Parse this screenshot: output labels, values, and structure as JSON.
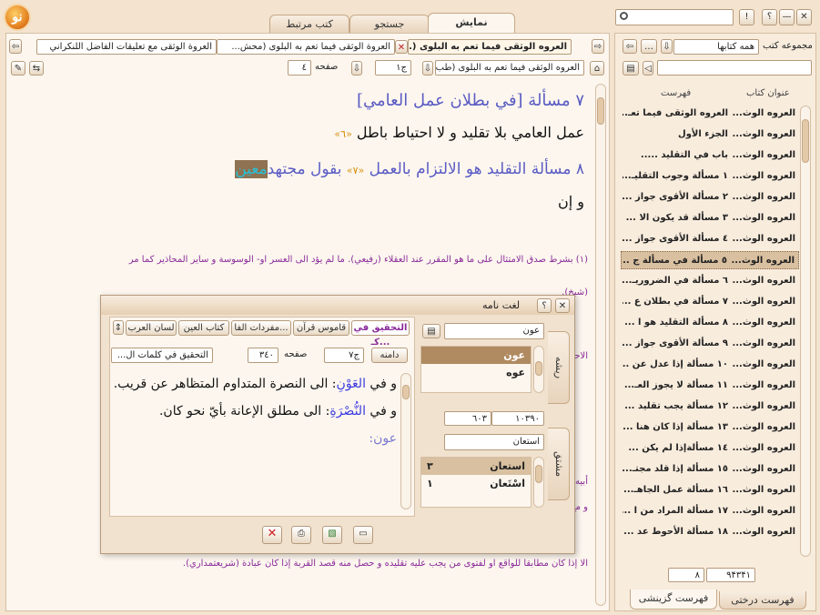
{
  "window": {
    "close": "✕",
    "minimize": "—",
    "help": "؟",
    "info": "!"
  },
  "search": {
    "placeholder": ""
  },
  "main_tabs": [
    "نمایش",
    "جستجو",
    "کتب مرتبط"
  ],
  "doc_tabs": [
    "العروه الوثقى فيما تعم به البلوى (...",
    "العروة الوثقى فيما تعم به البلوى (محش...",
    "العروة الوثقى مع تعليقات الفاضل اللنكراني"
  ],
  "book_select": "العروه الوثقى فيما تعم به البلوى (طب...",
  "volume": "ج١",
  "page_label": "صفحه",
  "page_value": "٤",
  "content": {
    "heading1": "٧ مسألة [في بطلان عمل العامي]",
    "line1": "عمل العامي بلا تقليد و لا احتياط باطل",
    "note1": "«٦»",
    "heading2": "٨ مسألة التقليد هو الالتزام بالعمل",
    "note2": "«٧»",
    "heading2_end": "بقول مجتهد",
    "heading2_hl": "معين",
    "line2": "و إن",
    "footnote1": "(١) بشرط صدق الامتثال على ما هو المقرر عند العقلاء (رفيعي). ما لم يؤد الى العسر او- الوسوسة و ساير المحاذير كما مر",
    "footnote1b": "(شيخ).",
    "side1": "الاحتياط في هذه",
    "side2": "أبيه (ح). إذا خالف",
    "side3": "و مع عدم الاعتماد",
    "footnote_last": "الا إذا كان مطابقا للواقع او لفتوى من يجب عليه تقليده و حصل منه قصد القربة إذا كان عبادة (شريعتمداري)."
  },
  "right_panel": {
    "group_label": "مجموعه کتب",
    "group_value": "همه کتابها",
    "col_index": "فهرست",
    "col_title": "عنوان كتاب",
    "rows": [
      {
        "title": "العروه الوث...",
        "index": "العروه الوثقى فيما تعـ..."
      },
      {
        "title": "العروه الوث...",
        "index": "الجزء الأول"
      },
      {
        "title": "العروه الوث...",
        "index": "باب في التقليد ....."
      },
      {
        "title": "العروه الوث...",
        "index": "١ مسألة وجوب التقليـ..."
      },
      {
        "title": "العروه الوث...",
        "index": "٢ مسألة الأقوى جواز ..."
      },
      {
        "title": "العروه الوث...",
        "index": "٣ مسألة قد يكون الا ..."
      },
      {
        "title": "العروه الوث...",
        "index": "٤ مسألة الأقوى جواز ..."
      },
      {
        "title": "العروه الوث...",
        "index": "٥ مسألة في مسألة ج ..."
      },
      {
        "title": "العروه الوث...",
        "index": "٦ مسألة في الضروريـ..."
      },
      {
        "title": "العروه الوث...",
        "index": "٧ مسألة في بطلان ع ..."
      },
      {
        "title": "العروه الوث...",
        "index": "٨ مسألة التقليد هو ا ..."
      },
      {
        "title": "العروه الوث...",
        "index": "٩ مسألة الأقوى جواز ..."
      },
      {
        "title": "العروه الوث...",
        "index": "١٠ مسألة إذا عدل عن ..."
      },
      {
        "title": "العروه الوث...",
        "index": "١١ مسألة لا يجوز العـ..."
      },
      {
        "title": "العروه الوث...",
        "index": "١٢ مسألة يجب تقليد ..."
      },
      {
        "title": "العروه الوث...",
        "index": "١٣ مسألة إذا كان هنا ..."
      },
      {
        "title": "العروه الوث...",
        "index": "١٤ مسألةإذا لم يكن ..."
      },
      {
        "title": "العروه الوث...",
        "index": "١٥ مسألة إذا قلد مجتـ..."
      },
      {
        "title": "العروه الوث...",
        "index": "١٦ مسألة عمل الجاهـ..."
      },
      {
        "title": "العروه الوث...",
        "index": "١٧ مسألة المراد من ا ..."
      },
      {
        "title": "العروه الوث...",
        "index": "١٨ مسألة الأحوط عد ..."
      }
    ],
    "selected_index": 7,
    "count1": "٩۴٣۴١",
    "count2": "٨",
    "bottom_tabs": [
      "فهرست درختی",
      "فهرست گزینشی"
    ]
  },
  "dialog": {
    "title": "لغت نامه",
    "dict_tabs": [
      "التحقيق في كـ...",
      "قاموس قرآن",
      "مفردات الفا...",
      "كتاب العين",
      "لسان العرب"
    ],
    "source_select": "التحقيق في كلمات ال...",
    "domain_btn": "دامنه",
    "volume": "ج٧",
    "page_label": "صفحه",
    "page_value": "٣٤٠",
    "text_line1_pre": "و في",
    "text_line1_word": "العَوْنِ",
    "text_line1_rest": ": الى النصرة المتداوم المتظاهر عن قريب.",
    "text_line2_pre": "و في",
    "text_line2_word": "النُّصْرَةِ",
    "text_line2_rest": ": الى مطلق الإعانة بأيّ نحو كان.",
    "text_line3": "عون:",
    "root_search": "عون",
    "root_list": [
      "عون",
      "عوه"
    ],
    "root_selected": 0,
    "range_from": "٦٠٣",
    "range_to": "١٠٣٩٠",
    "derived_search": "استعان",
    "derived_list": [
      {
        "word": "استعان",
        "count": "٣"
      },
      {
        "word": "اسْتَعان",
        "count": "١"
      }
    ],
    "derived_selected": 0,
    "side_label1": "ریشه",
    "side_label2": "مشتق"
  },
  "colors": {
    "accent": "#8a2a9a",
    "heading": "#5a5bc4",
    "highlight_bg": "#8e7252",
    "highlight_fg": "#28c0d6",
    "selected_row": "#d9c0a0",
    "note": "#d48a00"
  }
}
